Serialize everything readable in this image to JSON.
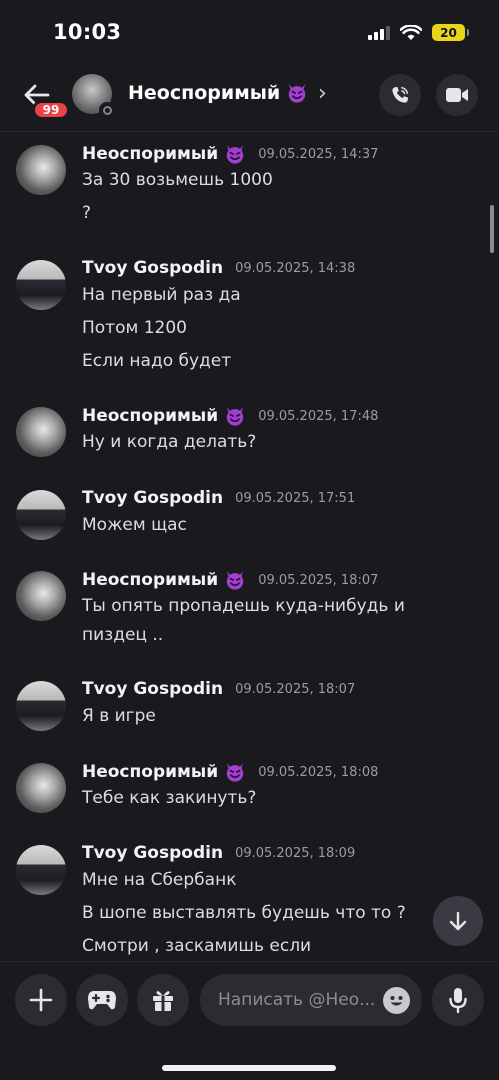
{
  "status_bar": {
    "time": "10:03",
    "battery": "20"
  },
  "header": {
    "unread_count": "99",
    "contact_name": "Неоспоримый",
    "chevron": "›",
    "icons": {
      "back": "arrow-left-icon",
      "call": "phone-icon",
      "video": "video-camera-icon"
    }
  },
  "messages": [
    {
      "author": "Неоспоримый",
      "has_emoji": true,
      "time": "09.05.2025, 14:37",
      "lines": [
        "За 30 возьмешь 1000",
        "?"
      ]
    },
    {
      "author": "Tvoy Gospodin",
      "has_emoji": false,
      "time": "09.05.2025, 14:38",
      "lines": [
        "На первый раз да",
        "Потом 1200",
        "Если надо будет"
      ]
    },
    {
      "author": "Неоспоримый",
      "has_emoji": true,
      "time": "09.05.2025, 17:48",
      "lines": [
        "Ну и когда делать?"
      ]
    },
    {
      "author": "Tvoy Gospodin",
      "has_emoji": false,
      "time": "09.05.2025, 17:51",
      "lines": [
        "Можем щас"
      ]
    },
    {
      "author": "Неоспоримый",
      "has_emoji": true,
      "time": "09.05.2025, 18:07",
      "lines": [
        "Ты опять пропадешь куда-нибудь и",
        "пиздец .."
      ]
    },
    {
      "author": "Tvoy Gospodin",
      "has_emoji": false,
      "time": "09.05.2025, 18:07",
      "lines": [
        "Я в игре"
      ]
    },
    {
      "author": "Неоспоримый",
      "has_emoji": true,
      "time": "09.05.2025, 18:08",
      "lines": [
        "Тебе как закинуть?"
      ]
    },
    {
      "author": "Tvoy Gospodin",
      "has_emoji": false,
      "time": "09.05.2025, 18:09",
      "lines": [
        "Мне на Сбербанк",
        "В шопе выставлять будешь что то ?",
        "Смотри , заскамишь если"
      ]
    }
  ],
  "composer": {
    "placeholder": "Написать @Нео...",
    "icons": {
      "plus": "plus-icon",
      "games": "gamepad-icon",
      "gift": "gift-icon",
      "emoji": "emoji-icon",
      "mic": "microphone-icon"
    }
  },
  "colors": {
    "background": "#1a1a1e",
    "badge": "#ed4245",
    "button_bg": "#2b2b30",
    "devil_emoji": "#a23fd0"
  }
}
